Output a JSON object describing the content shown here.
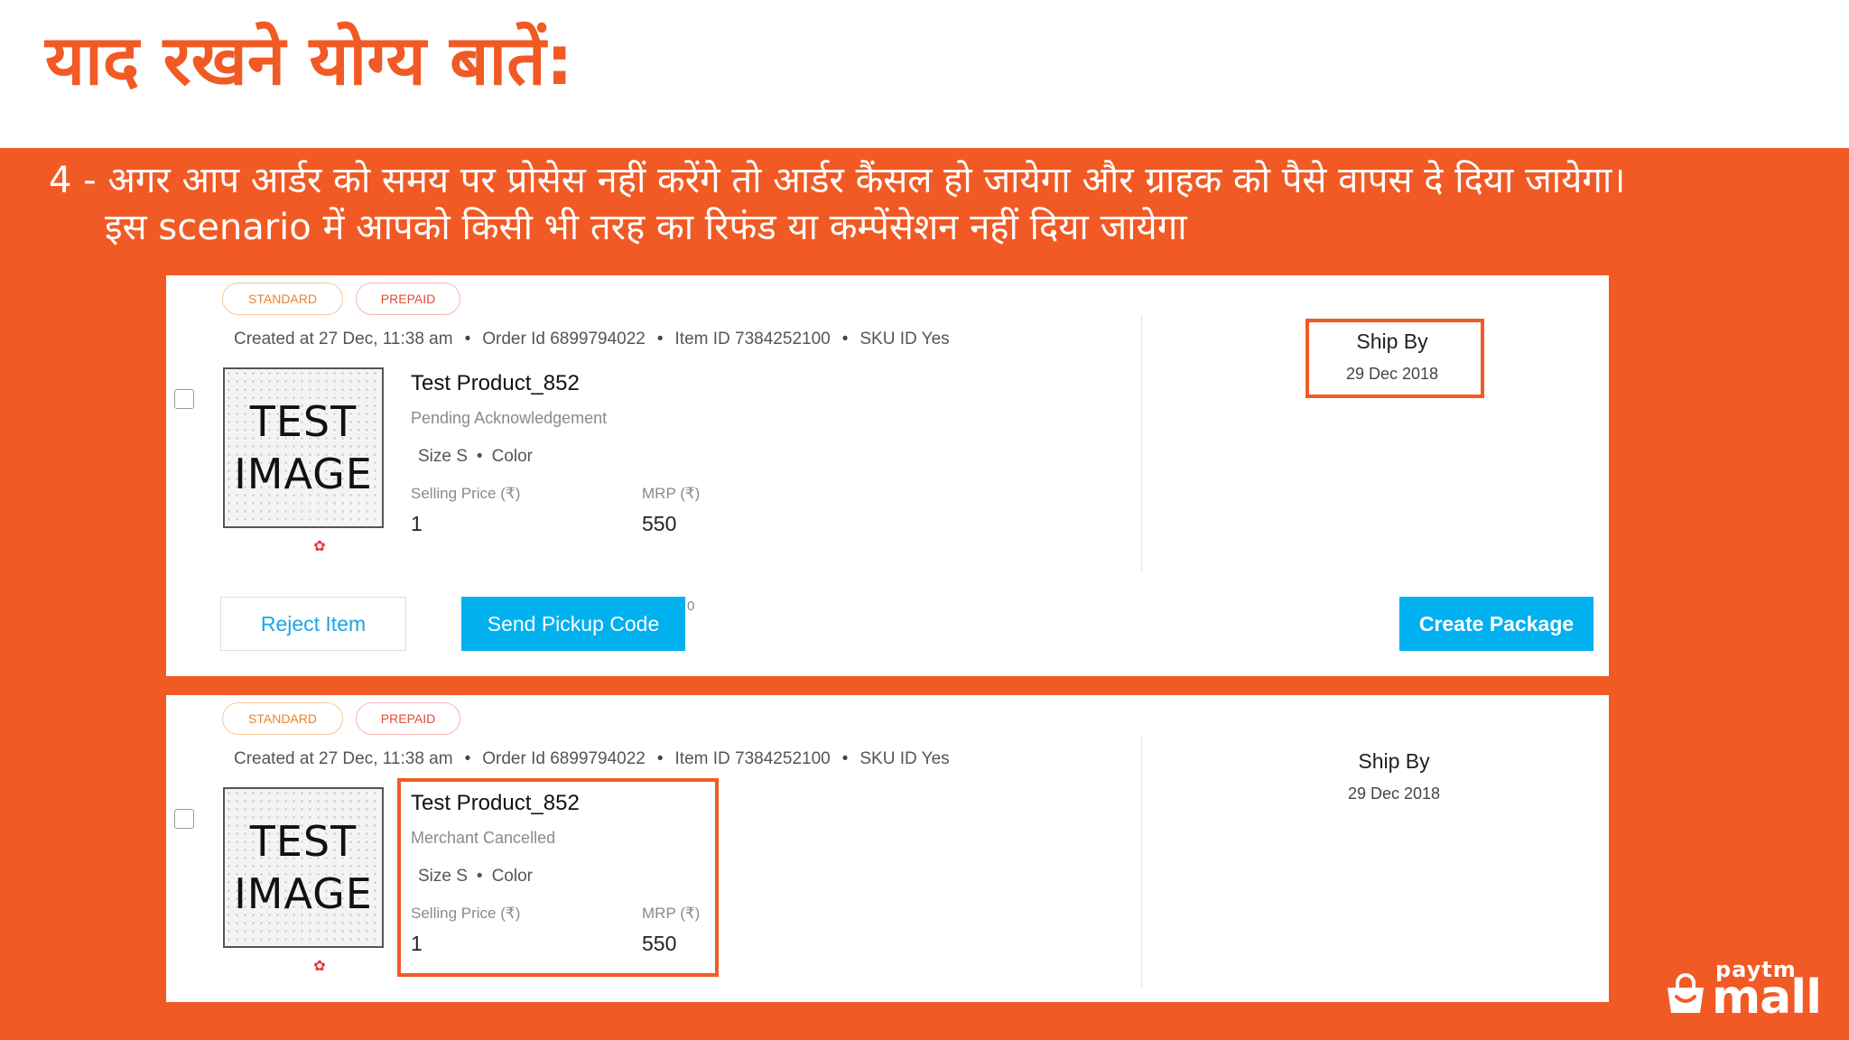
{
  "slide": {
    "title": "याद रखने योग्य बातें:",
    "intro_line1": "4 - अगर आप आर्डर को समय पर प्रोसेस नहीं करेंगे तो आर्डर कैंसल हो जायेगा और ग्राहक को पैसे वापस दे दिया जायेगा।",
    "intro_line2": "इस scenario में आपको किसी भी तरह का रिफंड या कम्पेंसेशन नहीं दिया जायेगा",
    "accent_color": "#f15a24"
  },
  "orders": [
    {
      "tags": [
        "STANDARD",
        "PREPAID"
      ],
      "created": "Created at 27 Dec, 11:38 am",
      "order_id": "Order Id 6899794022",
      "item_id": "Item ID 7384252100",
      "sku": "SKU ID Yes",
      "image_text": [
        "TEST",
        "IMAGE"
      ],
      "product_name": "Test Product_852",
      "status": "Pending Acknowledgement",
      "size": "Size S",
      "color": "Color",
      "selling_price_label": "Selling Price (₹)",
      "selling_price": "1",
      "mrp_label": "MRP (₹)",
      "mrp": "550",
      "ship_by_label": "Ship By",
      "ship_by_date": "29 Dec 2018",
      "reject_label": "Reject Item",
      "pickup_label": "Send Pickup Code",
      "pickup_count": "0",
      "create_label": "Create Package"
    },
    {
      "tags": [
        "STANDARD",
        "PREPAID"
      ],
      "created": "Created at 27 Dec, 11:38 am",
      "order_id": "Order Id 6899794022",
      "item_id": "Item ID 7384252100",
      "sku": "SKU ID Yes",
      "image_text": [
        "TEST",
        "IMAGE"
      ],
      "product_name": "Test Product_852",
      "status": "Merchant Cancelled",
      "size": "Size S",
      "color": "Color",
      "selling_price_label": "Selling Price (₹)",
      "selling_price": "1",
      "mrp_label": "MRP (₹)",
      "mrp": "550",
      "ship_by_label": "Ship By",
      "ship_by_date": "29 Dec 2018"
    }
  ],
  "logo": {
    "top": "paytm",
    "main": "mall"
  }
}
